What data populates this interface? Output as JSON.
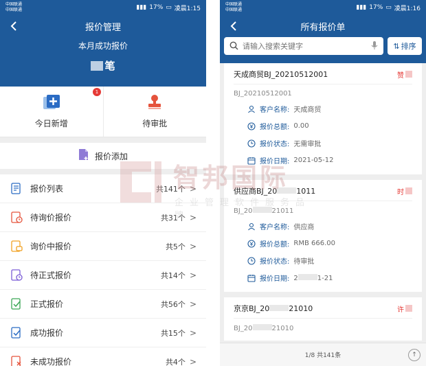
{
  "left": {
    "status": {
      "carrier1": "中国联通",
      "carrier2": "中国联通",
      "battery": "17%",
      "time": "凌晨1:15"
    },
    "nav": {
      "title": "报价管理"
    },
    "summary": {
      "subtitle": "本月成功报价",
      "unit": "笔"
    },
    "quick": [
      {
        "label": "今日新增",
        "badge": "1",
        "icon": "add-square-icon"
      },
      {
        "label": "待审批",
        "icon": "stamp-icon"
      }
    ],
    "add": {
      "label": "报价添加",
      "icon": "document-add-icon"
    },
    "menu": [
      {
        "label": "报价列表",
        "count": "共141个",
        "icon": "list-doc-icon",
        "color": "#2b6cc4"
      },
      {
        "label": "待询价报价",
        "count": "共31个",
        "icon": "clock-doc-icon",
        "color": "#e5533c"
      },
      {
        "label": "询价中报价",
        "count": "共5个",
        "icon": "chat-doc-icon",
        "color": "#f0a020"
      },
      {
        "label": "待正式报价",
        "count": "共14个",
        "icon": "clock-doc-icon",
        "color": "#7b5cd6"
      },
      {
        "label": "正式报价",
        "count": "共56个",
        "icon": "check-doc-icon",
        "color": "#3aa655"
      },
      {
        "label": "成功报价",
        "count": "共15个",
        "icon": "check-doc-icon",
        "color": "#2b6cc4"
      },
      {
        "label": "未成功报价",
        "count": "共4个",
        "icon": "x-doc-icon",
        "color": "#e5533c"
      }
    ]
  },
  "right": {
    "status": {
      "carrier1": "中国联通",
      "carrier2": "中国联通",
      "battery": "17%",
      "time": "凌晨1:16"
    },
    "nav": {
      "title": "所有报价单"
    },
    "search": {
      "placeholder": "请输入搜索关键字",
      "sort_label": "排序"
    },
    "labels": {
      "customer": "客户名称:",
      "total": "报价总额:",
      "state": "报价状态:",
      "date": "报价日期:"
    },
    "cards": [
      {
        "title": "天成商贸BJ_20210512001",
        "tag": "赞",
        "code": "BJ_20210512001",
        "customer": "天成商贸",
        "total": "0.00",
        "state": "无需审批",
        "date": "2021-05-12"
      },
      {
        "title": "供应商BJ_20",
        "title_end": "1011",
        "tag": "时",
        "code": "BJ_20",
        "code_end": "21011",
        "customer": "供应商",
        "total": "RMB 666.00",
        "state": "待审批",
        "date": "2",
        "date_end": "1-21"
      },
      {
        "title": "京京BJ_20",
        "title_end": "21010",
        "tag": "许",
        "code": "BJ_20",
        "code_end": "21010"
      }
    ],
    "footer": {
      "pagination": "1/8 共141条"
    }
  },
  "watermark": {
    "title": "智邦国际",
    "subtitle": "企业管理软件服务品牌"
  },
  "colors": {
    "brand": "#1e5a9a",
    "danger": "#e53935"
  }
}
